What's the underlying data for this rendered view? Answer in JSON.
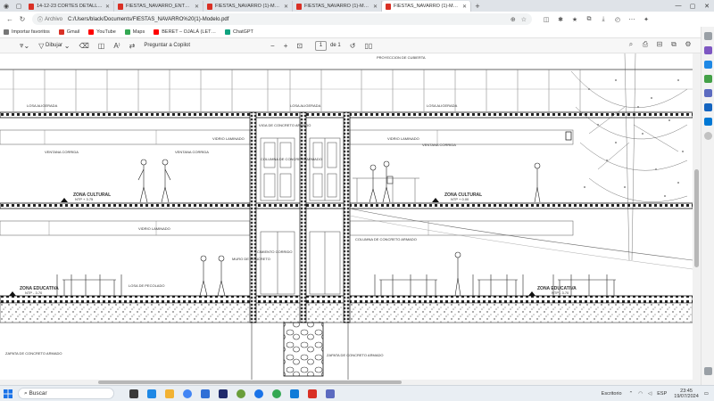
{
  "browser": {
    "tabs": [
      {
        "label": "14-12-23 CORTES DETALLADOS"
      },
      {
        "label": "FIESTAS_NAVARRO_ENTREGA_FI"
      },
      {
        "label": "FIESTAS_NAVARRO (1)-Modelo.p"
      },
      {
        "label": "FIESTAS_NAVARRO (1)-Modelo.p"
      },
      {
        "label": "FIESTAS_NAVARRO (1)-Modelo.p"
      }
    ],
    "address": {
      "scheme_label": "Archivo",
      "url": "C:/Users/black/Documents/FIESTAS_NAVARRO%20(1)-Modelo.pdf"
    },
    "bookmarks": [
      {
        "label": "Importar favoritos",
        "color": "#777777"
      },
      {
        "label": "Gmail",
        "color": "#d93025"
      },
      {
        "label": "YouTube",
        "color": "#ff0000"
      },
      {
        "label": "Maps",
        "color": "#34a853"
      },
      {
        "label": "BERET – OJALÁ (LET…",
        "color": "#ff0000"
      },
      {
        "label": "ChatGPT",
        "color": "#10a37f"
      }
    ]
  },
  "pdf_toolbar": {
    "draw_label": "Dibujar",
    "copilot_label": "Preguntar a Copilot",
    "page_value": "1",
    "page_total": "de 1"
  },
  "drawing": {
    "labels": {
      "proyeccion": "PROYECCION DE CUBIERTA",
      "losa_top1": "LOSA ALIGERADA",
      "losa_top2": "LOSA ALIGERADA",
      "losa_top3": "LOSA ALIGERADA",
      "viga_concreto": "VIGA DE CONCRETO ARMADO",
      "vidrio_lam1": "VIDRIO LAMINADO",
      "vidrio_lam2": "VIDRIO LAMINADO",
      "vidrio_lam3": "VIDRIO LAMINADO",
      "ventana1": "VENTANA CORRIDA",
      "ventana2": "VENTANA CORRIDA",
      "ventana3": "VENTANA CORRIDA",
      "col_concreto1": "COLUMNA DE CONCRETO ARMADO",
      "col_concreto2": "COLUMNA DE CONCRETO ARMADO",
      "zona_cultural1": "ZONA CULTURAL",
      "ntp1": "NTP + 3.75",
      "zona_cultural2": "ZONA CULTURAL",
      "ntp2": "NTP + 0.00",
      "zona_educativa1": "ZONA EDUCATIVA",
      "ntp3": "NTP - 3.70",
      "zona_educativa2": "ZONA EDUCATIVA",
      "ntp4": "NTP - 3.70",
      "losa_ped": "LOSA DE PECOLADO",
      "zapata": "ZAPATA DE CONCRETO ARMADO",
      "zapata2": "ZAPATA DE CONCRETO ARMADO",
      "muro": "MURO DE CONCRETO",
      "cimiento": "CIMIENTO CORRIDO"
    }
  },
  "taskbar": {
    "search_placeholder": "Buscar",
    "apps": [
      {
        "color": "#3a3a3a"
      },
      {
        "color": "#1e88e5"
      },
      {
        "color": "#f2b233"
      },
      {
        "color": "#4285f4"
      },
      {
        "color": "#2f6fd6"
      },
      {
        "color": "#1f2a6b"
      },
      {
        "color": "#6a9e3a"
      },
      {
        "color": "#1a73e8"
      },
      {
        "color": "#34a853"
      },
      {
        "color": "#0f7bd8"
      },
      {
        "color": "#d93025"
      },
      {
        "color": "#5c6bc0"
      }
    ],
    "weather": "Escritorio",
    "lang": "ESP",
    "time": "23:45",
    "date": "19/07/2024"
  }
}
